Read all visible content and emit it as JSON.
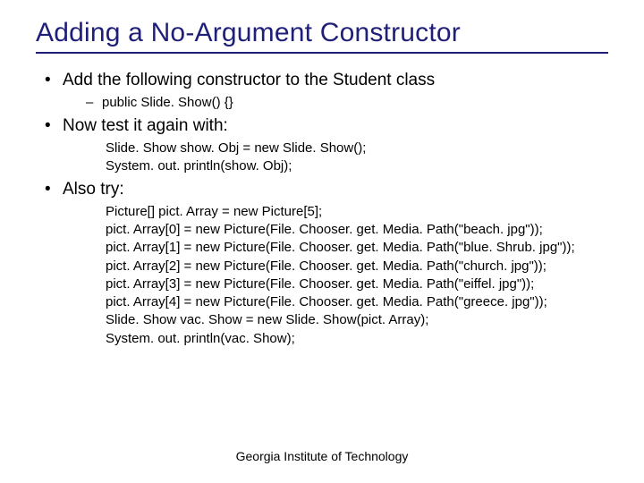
{
  "title": "Adding a No-Argument Constructor",
  "bullets": {
    "b1": "Add the following constructor to the Student class",
    "b1_sub": "public Slide. Show() {}",
    "b2": "Now test it again with:",
    "b2_code": {
      "l0": "Slide. Show show. Obj = new Slide. Show();",
      "l1": "System. out. println(show. Obj);"
    },
    "b3": "Also try:",
    "b3_code": {
      "l0": "Picture[] pict. Array = new Picture[5];",
      "l1": "pict. Array[0] = new Picture(File. Chooser. get. Media. Path(\"beach. jpg\"));",
      "l2": "pict. Array[1] = new Picture(File. Chooser. get. Media. Path(\"blue. Shrub. jpg\"));",
      "l3": "pict. Array[2] = new Picture(File. Chooser. get. Media. Path(\"church. jpg\"));",
      "l4": "pict. Array[3] = new Picture(File. Chooser. get. Media. Path(\"eiffel. jpg\"));",
      "l5": "pict. Array[4] = new Picture(File. Chooser. get. Media. Path(\"greece. jpg\"));",
      "l6": "Slide. Show vac. Show = new Slide. Show(pict. Array);",
      "l7": "System. out. println(vac. Show);"
    }
  },
  "footer": "Georgia Institute of Technology"
}
